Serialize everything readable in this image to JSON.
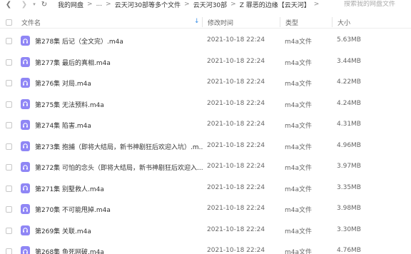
{
  "nav": {
    "back_icon": "chevron-left-icon",
    "forward_icon": "chevron-right-icon",
    "history_icon": "chevron-down-icon",
    "refresh_icon": "refresh-icon",
    "breadcrumb": [
      "我的网盘",
      "...",
      "云天河30部等多个文件",
      "云天河30部",
      "Z 罪恶的边缘【云天河】"
    ],
    "separator": ">",
    "search_placeholder": "搜索我的网盘文件"
  },
  "columns": {
    "name": "文件名",
    "modified": "修改时间",
    "type": "类型",
    "size": "大小",
    "sort_icon": "sort-down-arrow-icon"
  },
  "file_icon": "audio-file-icon",
  "accent_color": "#8f86f5",
  "files": [
    {
      "name": "第278集 后记（全文完）.m4a",
      "modified": "2021-10-18 22:24",
      "type": "m4a文件",
      "size": "5.63MB"
    },
    {
      "name": "第277集 最后的真相.m4a",
      "modified": "2021-10-18 22:24",
      "type": "m4a文件",
      "size": "3.44MB"
    },
    {
      "name": "第276集 对局.m4a",
      "modified": "2021-10-18 22:24",
      "type": "m4a文件",
      "size": "4.22MB"
    },
    {
      "name": "第275集 无法预料.m4a",
      "modified": "2021-10-18 22:24",
      "type": "m4a文件",
      "size": "4.24MB"
    },
    {
      "name": "第274集 陷害.m4a",
      "modified": "2021-10-18 22:24",
      "type": "m4a文件",
      "size": "4.31MB"
    },
    {
      "name": "第273集 抱捕（即将大结局，新书神剧狂后欢迎入坑）.m...",
      "modified": "2021-10-18 22:24",
      "type": "m4a文件",
      "size": "4.96MB"
    },
    {
      "name": "第272集 可怕的念头（即将大结局，新书神剧狂后欢迎入...",
      "modified": "2021-10-18 22:24",
      "type": "m4a文件",
      "size": "3.97MB"
    },
    {
      "name": "第271集 别墅救人.m4a",
      "modified": "2021-10-18 22:24",
      "type": "m4a文件",
      "size": "3.35MB"
    },
    {
      "name": "第270集 不可能甩掉.m4a",
      "modified": "2021-10-18 22:24",
      "type": "m4a文件",
      "size": "3.98MB"
    },
    {
      "name": "第269集 关联.m4a",
      "modified": "2021-10-18 22:24",
      "type": "m4a文件",
      "size": "3.30MB"
    },
    {
      "name": "第268集 鱼死网破.m4a",
      "modified": "2021-10-18 22:24",
      "type": "m4a文件",
      "size": "4.76MB"
    }
  ]
}
